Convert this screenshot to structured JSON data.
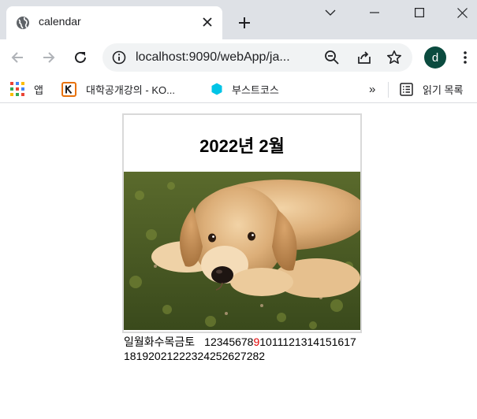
{
  "browser": {
    "tab": {
      "title": "calendar",
      "close_icon": "close-icon"
    },
    "new_tab_icon": "plus-icon",
    "window_controls": [
      "chevron-down-icon",
      "minimize-icon",
      "maximize-icon",
      "close-icon"
    ],
    "toolbar": {
      "url": "localhost:9090/webApp/ja...",
      "profile_initial": "d",
      "profile_color": "#0b4b3f"
    },
    "bookmarks": {
      "apps_label": "앱",
      "items": [
        {
          "label": "대학공개강의 - KO...",
          "icon": "kocw-icon",
          "color": "#e8710a"
        },
        {
          "label": "부스트코스",
          "icon": "boostcourse-icon",
          "color": "#00c4e6"
        }
      ],
      "overflow": "»",
      "reading_list": "읽기 목록"
    }
  },
  "page": {
    "heading": "2022년 2월",
    "image_subject": "golden retriever puppy lying on grass",
    "weekday_header": "일월화수목금토",
    "days_before_highlight": "12345678",
    "highlight_day": "9",
    "days_after_highlight": "1011121314",
    "days_line2": "15161718192021222324252627282",
    "highlight_color": "#e00000"
  }
}
